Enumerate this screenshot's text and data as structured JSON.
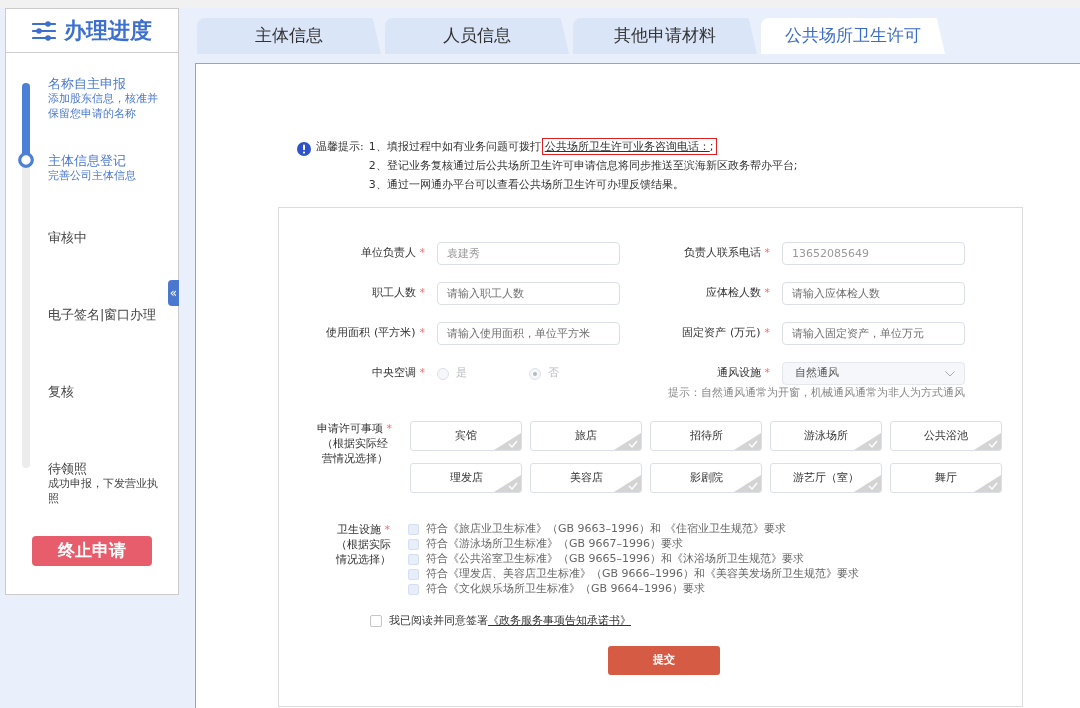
{
  "sidebar": {
    "title": "办理进度",
    "steps": [
      {
        "title": "名称自主申报",
        "description": "添加股东信息，核准并保留您申请的名称",
        "active": true
      },
      {
        "title": "主体信息登记",
        "description": "完善公司主体信息",
        "active": true
      },
      {
        "title": "审核中",
        "active": false
      },
      {
        "title": "电子签名|窗口办理",
        "active": false
      },
      {
        "title": "复核",
        "active": false
      },
      {
        "title": "待领照",
        "description": "成功申报，下发营业执照",
        "active": false
      }
    ],
    "collapse_button": "«",
    "stop_button": "终止申请"
  },
  "tabs": [
    {
      "label": "主体信息",
      "selected": false
    },
    {
      "label": "人员信息",
      "selected": false
    },
    {
      "label": "其他申请材料",
      "selected": false
    },
    {
      "label": "公共场所卫生许可",
      "selected": true
    }
  ],
  "notice": {
    "label": "温馨提示:",
    "lines": [
      {
        "text": "1、填报过程中如有业务问题可拨打",
        "link": "公共场所卫生许可业务咨询电话：",
        "after": ";",
        "highlighted": true
      },
      {
        "text": "2、登记业务复核通过后公共场所卫生许可申请信息将同步推送至滨海新区政务帮办平台;"
      },
      {
        "text": "3、通过一网通办平台可以查看公共场所卫生许可办理反馈结果。"
      }
    ]
  },
  "form": {
    "fields": [
      {
        "kind": "input",
        "label": "单位负责人",
        "required_mark": "*",
        "value": "袁建秀",
        "disabled": true
      },
      {
        "kind": "input",
        "label": "负责人联系电话",
        "required_mark": "*",
        "value": "13652085649",
        "disabled": true
      },
      {
        "kind": "input",
        "label": "职工人数",
        "required_mark": "*",
        "placeholder": "请输入职工人数",
        "disabled": false
      },
      {
        "kind": "input",
        "label": "应体检人数",
        "required_mark": "*",
        "placeholder": "请输入应体检人数",
        "disabled": false
      },
      {
        "kind": "input",
        "label": "使用面积 (平方米)",
        "required_mark": "*",
        "placeholder": "请输入使用面积，单位平方米",
        "disabled": false
      },
      {
        "kind": "input",
        "label": "固定资产 (万元)",
        "required_mark": "*",
        "placeholder": "请输入固定资产，单位万元",
        "disabled": false
      },
      {
        "kind": "radio",
        "label": "中央空调",
        "required_mark": "*",
        "disabled": true,
        "options": [
          {
            "label": "是",
            "selected": false
          },
          {
            "label": "否",
            "selected": true
          }
        ]
      },
      {
        "kind": "select",
        "label": "通风设施",
        "required_mark": "*",
        "value": "自然通风",
        "disabled": true,
        "hint": "提示：自然通风通常为开窗，机械通风通常为非人为方式通风"
      }
    ],
    "permit_items": {
      "label": "申请许可事项",
      "required_mark": "*",
      "note": "（根据实际经营情况选择）",
      "options": [
        {
          "label": "宾馆",
          "selected": false
        },
        {
          "label": "旅店",
          "selected": false
        },
        {
          "label": "招待所",
          "selected": false
        },
        {
          "label": "游泳场所",
          "selected": false
        },
        {
          "label": "公共浴池",
          "selected": false
        },
        {
          "label": "理发店",
          "selected": false
        },
        {
          "label": "美容店",
          "selected": false
        },
        {
          "label": "影剧院",
          "selected": false
        },
        {
          "label": "游艺厅（室）",
          "selected": false
        },
        {
          "label": "舞厅",
          "selected": false
        }
      ]
    },
    "sanitation": {
      "label": "卫生设施",
      "required_mark": "*",
      "note": "（根据实际情况选择）",
      "items": [
        {
          "label": "符合《旅店业卫生标准》（GB 9663–1996）和 《住宿业卫生规范》要求",
          "checked": false,
          "disabled": true
        },
        {
          "label": "符合《游泳场所卫生标准》（GB 9667–1996）要求",
          "checked": false,
          "disabled": true
        },
        {
          "label": "符合《公共浴室卫生标准》（GB 9665–1996）和《沐浴场所卫生规范》要求",
          "checked": false,
          "disabled": true
        },
        {
          "label": "符合《理发店、美容店卫生标准》（GB 9666–1996）和《美容美发场所卫生规范》要求",
          "checked": false,
          "disabled": true
        },
        {
          "label": "符合《文化娱乐场所卫生标准》（GB 9664–1996）要求",
          "checked": false,
          "disabled": true
        }
      ]
    },
    "agreement": {
      "text": "我已阅读并同意签署",
      "link": "《政务服务事项告知承诺书》",
      "checked": false
    },
    "submit_button": "提交"
  }
}
